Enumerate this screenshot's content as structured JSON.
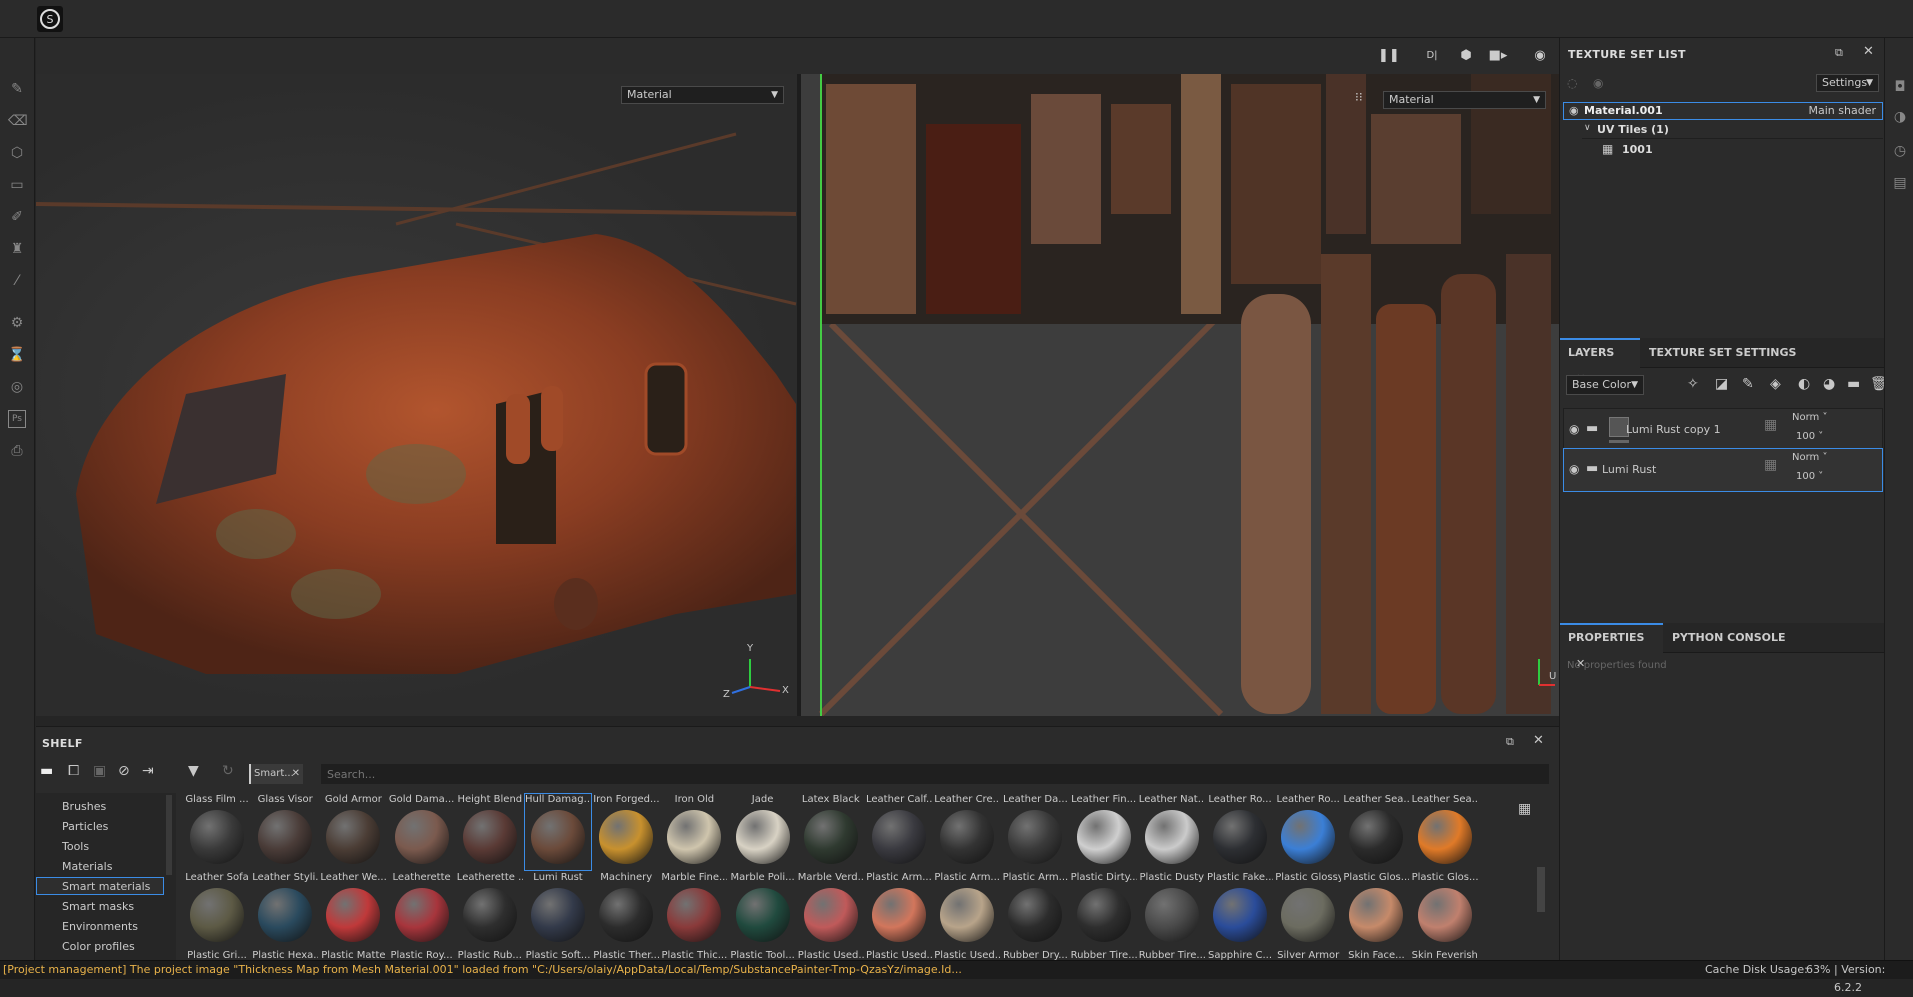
{
  "topbar": {
    "logo_icon": "substance-logo-icon"
  },
  "viewport_3d": {
    "mode": "Material",
    "axis": {
      "y": "Y",
      "x": "X",
      "z": "Z"
    }
  },
  "viewport_2d": {
    "mode": "Material",
    "axis_u": "U"
  },
  "texture_set_list": {
    "title": "TEXTURE SET LIST",
    "settings_label": "Settings",
    "material_name": "Material.001",
    "shader": "Main shader",
    "uv_tiles_label": "UV Tiles (1)",
    "tile": "1001"
  },
  "layers_panel": {
    "tabs": [
      "LAYERS",
      "TEXTURE SET SETTINGS"
    ],
    "channel": "Base Color",
    "layers": [
      {
        "name": "Lumi Rust copy 1",
        "blend": "Norm",
        "opacity": "100"
      },
      {
        "name": "Lumi Rust",
        "blend": "Norm",
        "opacity": "100"
      }
    ]
  },
  "properties_panel": {
    "tabs": [
      "PROPERTIES",
      "PYTHON CONSOLE"
    ],
    "empty_text": "No properties found"
  },
  "shelf": {
    "title": "SHELF",
    "filter_tag": "Smart...",
    "search_placeholder": "Search...",
    "categories": [
      "Brushes",
      "Particles",
      "Tools",
      "Materials",
      "Smart materials",
      "Smart masks",
      "Environments",
      "Color profiles"
    ],
    "selected_category": "Smart materials",
    "row1": [
      {
        "name": "Glass Film ...",
        "color": "#3a3a3a"
      },
      {
        "name": "Glass Visor",
        "color": "#4a3c38"
      },
      {
        "name": "Gold Armor",
        "color": "#4b3d35"
      },
      {
        "name": "Gold Dama...",
        "color": "#7b5a4e"
      },
      {
        "name": "Height Blend",
        "color": "#5a3a35"
      },
      {
        "name": "Hull Damag...",
        "color": "#6b4a3a"
      },
      {
        "name": "Iron Forged...",
        "color": "#c8912e"
      },
      {
        "name": "Iron Old",
        "color": "#cfc5ad"
      },
      {
        "name": "Jade",
        "color": "#d8d2c4"
      },
      {
        "name": "Latex Black",
        "color": "#2f3a30"
      },
      {
        "name": "Leather Calf...",
        "color": "#3a3a40"
      },
      {
        "name": "Leather Cre...",
        "color": "#333333"
      },
      {
        "name": "Leather Da...",
        "color": "#3a3a3a"
      },
      {
        "name": "Leather Fin...",
        "color": "#cfcfcf"
      },
      {
        "name": "Leather Nat...",
        "color": "#cbcbcb"
      },
      {
        "name": "Leather Ro...",
        "color": "#2d2f33"
      },
      {
        "name": "Leather Ro...",
        "color": "#3b7fd6"
      },
      {
        "name": "Leather Sea...",
        "color": "#2b2b2b"
      },
      {
        "name": "Leather Sea...",
        "color": "#e07a28"
      }
    ],
    "row2": [
      {
        "name": "Leather Sofa",
        "color": "#5d5a45"
      },
      {
        "name": "Leather Styli...",
        "color": "#2a4a5e"
      },
      {
        "name": "Leather We...",
        "color": "#c0393a"
      },
      {
        "name": "Leatherette",
        "color": "#a8353c"
      },
      {
        "name": "Leatherette ...",
        "color": "#2e2e2e"
      },
      {
        "name": "Lumi Rust",
        "color": "#333a4a"
      },
      {
        "name": "Machinery",
        "color": "#2c2c2c"
      },
      {
        "name": "Marble Fine...",
        "color": "#8a3a3a"
      },
      {
        "name": "Marble Poli...",
        "color": "#204a3e"
      },
      {
        "name": "Marble Verd...",
        "color": "#c05a5a"
      },
      {
        "name": "Plastic Arm...",
        "color": "#d2765c"
      },
      {
        "name": "Plastic Arm...",
        "color": "#b8a48a"
      },
      {
        "name": "Plastic Arm...",
        "color": "#2c2c2c"
      },
      {
        "name": "Plastic Dirty...",
        "color": "#2e2e2e"
      },
      {
        "name": "Plastic Dusty",
        "color": "#4a4a4a"
      },
      {
        "name": "Plastic Fake...",
        "color": "#2a4c9a"
      },
      {
        "name": "Plastic Glossy",
        "color": "#6c6c60"
      },
      {
        "name": "Plastic Glos...",
        "color": "#c68a6a"
      },
      {
        "name": "Plastic Glos...",
        "color": "#c0806e"
      }
    ],
    "row3_labels": [
      "Plastic Gri...",
      "Plastic Hexa...",
      "Plastic Matte",
      "Plastic Roy...",
      "Plastic Rub...",
      "Plastic Soft...",
      "Plastic Ther...",
      "Plastic Thic...",
      "Plastic Tool...",
      "Plastic Used...",
      "Plastic Used...",
      "Plastic Used...",
      "Rubber Dry...",
      "Rubber Tire...",
      "Rubber Tire...",
      "Sapphire C...",
      "Silver Armor",
      "Skin Face...",
      "Skin Feverish"
    ]
  },
  "statusbar": {
    "message": "[Project management] The project image \"Thickness Map from Mesh Material.001\" loaded from \"C:/Users/olaiy/AppData/Local/Temp/SubstancePainter-Tmp-QzasYz/image.Id...",
    "cache_label": "Cache Disk Usage:",
    "cache_value": "63%",
    "version": "| Version: 6.2.2"
  }
}
